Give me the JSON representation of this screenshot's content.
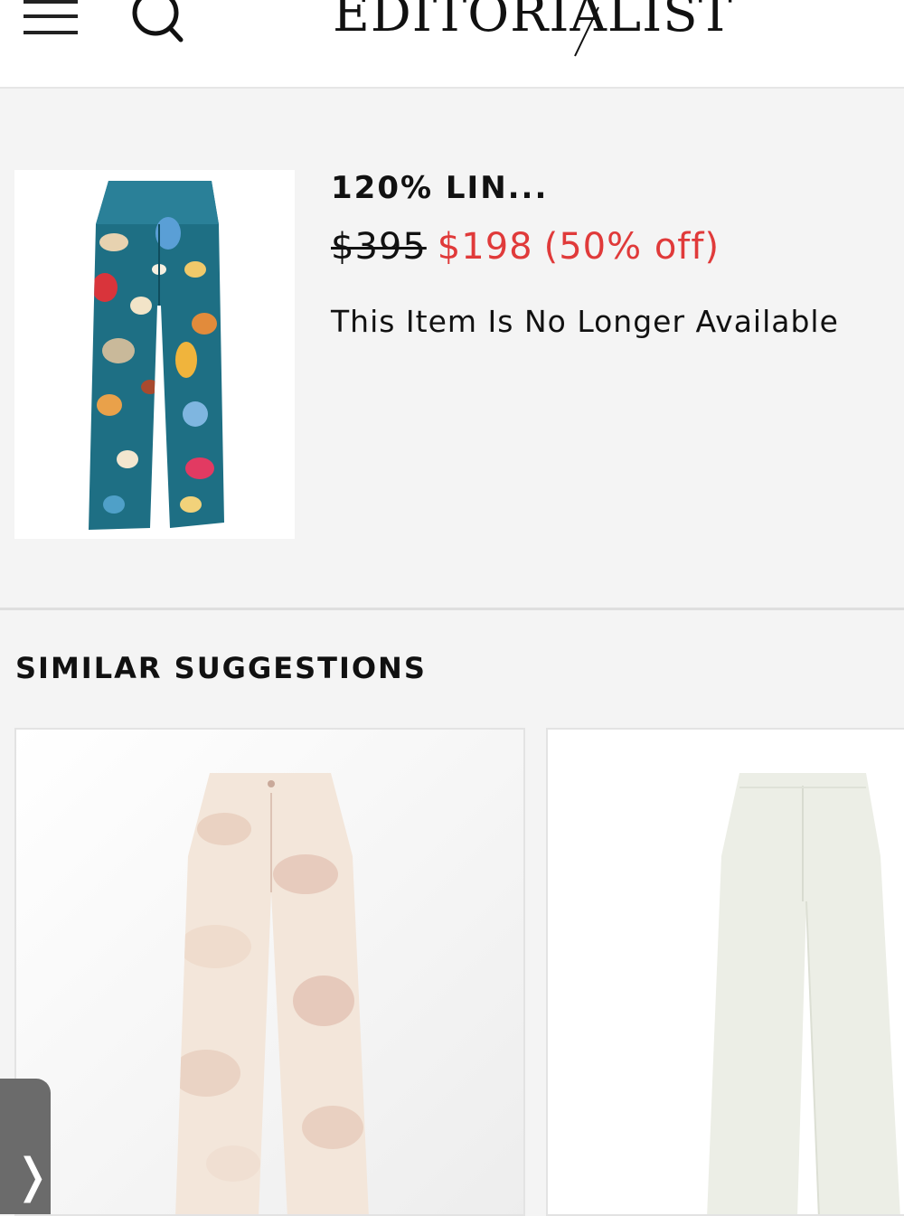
{
  "header": {
    "logo_text": "EDITORIALIST",
    "menu_icon": "hamburger-menu-icon",
    "search_icon": "search-icon"
  },
  "product": {
    "name": "120% LIN...",
    "original_price": "$395",
    "sale_price": "$198",
    "discount": "(50% off)",
    "availability": "This Item Is No Longer Available",
    "image_icon": "butterfly-print-pants-image"
  },
  "similar": {
    "title": "SIMILAR SUGGESTIONS",
    "items": [
      {
        "image_icon": "camouflage-linen-pants-image"
      },
      {
        "image_icon": "white-wide-leg-pants-image"
      }
    ]
  },
  "side_tab": {
    "chevron": "❭",
    "icon": "chevron-right-icon"
  },
  "colors": {
    "sale_red": "#e03a3a",
    "background": "#f4f4f4",
    "text": "#111111"
  }
}
